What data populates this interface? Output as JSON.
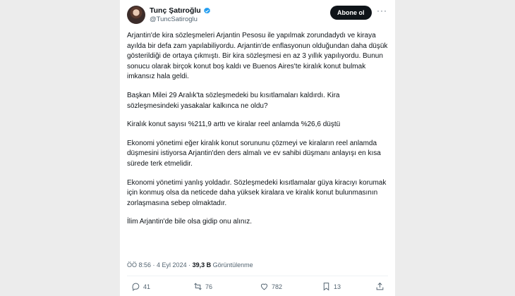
{
  "author": {
    "name": "Tunç Şatıroğlu",
    "handle": "@TuncSatiroglu",
    "verified": true
  },
  "follow_label": "Abone ol",
  "more_icon": "more-icon",
  "paragraphs": [
    "Arjantin'de kira sözleşmeleri Arjantin Pesosu ile yapılmak zorundadydı ve kiraya ayılda bir defa zam yapılabiliyordu. Arjantin'de enflasyonun olduğundan daha düşük gösterildiği de ortaya çıkmıştı. Bir kira sözleşmesi en az 3 yıllık yapılıyordu. Bunun sonucu olarak birçok konut boş kaldı ve Buenos Aires'te kiralık konut bulmak imkansız hala geldi.",
    "Başkan Milei 29 Aralık'ta sözleşmedeki bu kısıtlamaları kaldırdı. Kira sözleşmesindeki yasakalar kalkınca ne oldu?",
    "Kiralık konut sayısı %211,9 arttı ve kiralar reel anlamda %26,6 düştü",
    "Ekonomi yönetimi eğer kiralık konut sorununu çözmeyi ve kiraların reel anlamda düşmesini istiyorsa Arjantin'den ders almalı ve ev sahibi düşmanı anlayışı en kısa sürede terk etmelidir.",
    "Ekonomi yönetimi yanlış yoldadır. Sözleşmedeki kısıtlamalar güya kiracıyı korumak için konmuş olsa da neticede daha yüksek kiralara ve kiralık konut bulunmasının zorlaşmasına sebep olmaktadır.",
    "İlim Arjantin'de bile olsa gidip onu alınız."
  ],
  "meta": {
    "time": "ÖÖ 8:56",
    "date": "4 Eyl 2024",
    "views": "39,3 B",
    "views_label": "Görüntülenme"
  },
  "actions": {
    "replies": "41",
    "reposts": "76",
    "likes": "782",
    "bookmarks": "13"
  },
  "colors": {
    "accent": "#1d9bf0",
    "text": "#0f1419",
    "muted": "#536471",
    "button": "#0f1419"
  }
}
